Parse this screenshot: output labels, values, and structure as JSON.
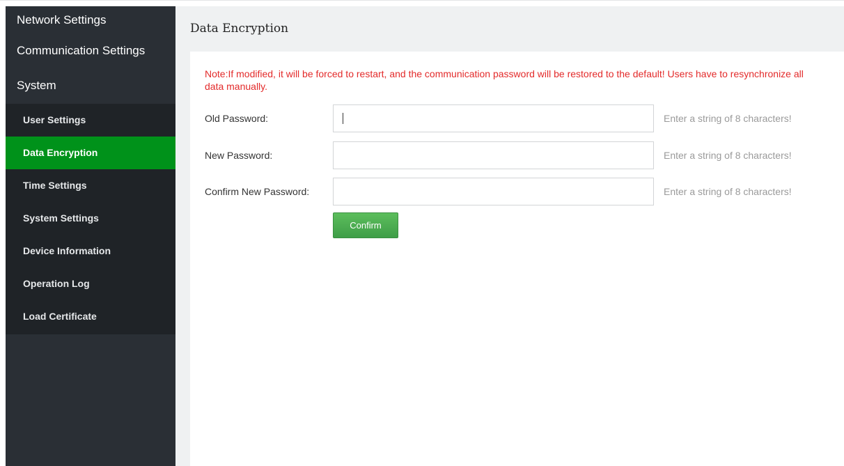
{
  "sidebar": {
    "groups": [
      {
        "label": "Network Settings"
      },
      {
        "label": "Communication Settings"
      },
      {
        "label": "System"
      }
    ],
    "items": [
      {
        "label": "User Settings"
      },
      {
        "label": "Data Encryption"
      },
      {
        "label": "Time Settings"
      },
      {
        "label": "System Settings"
      },
      {
        "label": "Device Information"
      },
      {
        "label": "Operation Log"
      },
      {
        "label": "Load Certificate"
      }
    ],
    "active_item": "Data Encryption",
    "active_color": "#00921a"
  },
  "main": {
    "title": "Data Encryption",
    "note": "Note:If modified, it will be forced to restart, and the communication password will be restored to the default! Users have to resynchronize all data manually.",
    "note_color": "#e32a2a",
    "fields": [
      {
        "label": "Old Password:",
        "value": "",
        "hint": "Enter a string of 8 characters!"
      },
      {
        "label": "New Password:",
        "value": "",
        "hint": "Enter a string of 8 characters!"
      },
      {
        "label": "Confirm New Password:",
        "value": "",
        "hint": "Enter a string of 8 characters!"
      }
    ],
    "confirm_label": "Confirm"
  }
}
